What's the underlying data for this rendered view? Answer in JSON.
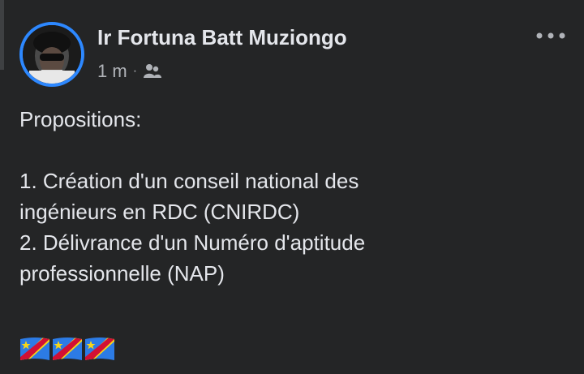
{
  "post": {
    "author": "Ir Fortuna Batt Muziongo",
    "timestamp": "1 m",
    "separator": "·",
    "audience_icon": "friends-icon",
    "more_icon": "more-horizontal-icon",
    "text": {
      "heading": "Propositions:",
      "lines": [
        "1. Création d'un conseil national des",
        "ingénieurs en RDC (CNIRDC)",
        "2. Délivrance d'un Numéro d'aptitude",
        "professionnelle (NAP)"
      ]
    },
    "emoji": [
      "flag-drc-icon",
      "flag-drc-icon",
      "flag-drc-icon"
    ]
  },
  "colors": {
    "background": "#242526",
    "text_primary": "#e4e6eb",
    "text_secondary": "#b0b3b8",
    "avatar_ring": "#2d88ff"
  }
}
